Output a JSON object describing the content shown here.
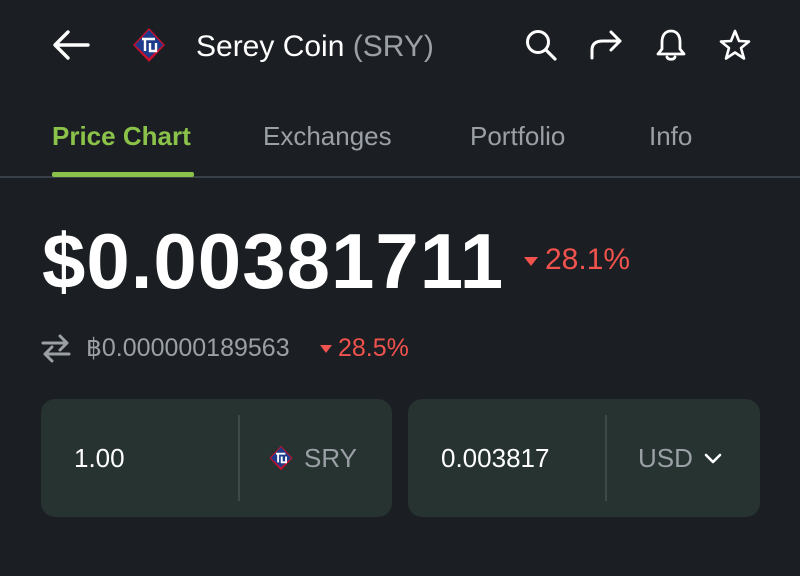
{
  "header": {
    "coin_name": "Serey Coin",
    "coin_symbol": "(SRY)",
    "icons": [
      "back-arrow-icon",
      "coin-logo",
      "search-icon",
      "share-icon",
      "bell-icon",
      "star-icon"
    ]
  },
  "tabs": [
    {
      "label": "Price Chart",
      "active": true
    },
    {
      "label": "Exchanges",
      "active": false
    },
    {
      "label": "Portfolio",
      "active": false
    },
    {
      "label": "Info",
      "active": false
    }
  ],
  "price": {
    "usd": "$0.00381711",
    "usd_change": "28.1%",
    "btc": "฿0.000000189563",
    "btc_change": "28.5%"
  },
  "converter": {
    "left_amount": "1.00",
    "left_unit": "SRY",
    "right_amount": "0.003817",
    "right_unit": "USD"
  },
  "colors": {
    "background": "#1b1e22",
    "accent": "#8bc34a",
    "negative": "#f0524d",
    "card": "#263330",
    "muted_text": "#9aa0a6"
  }
}
